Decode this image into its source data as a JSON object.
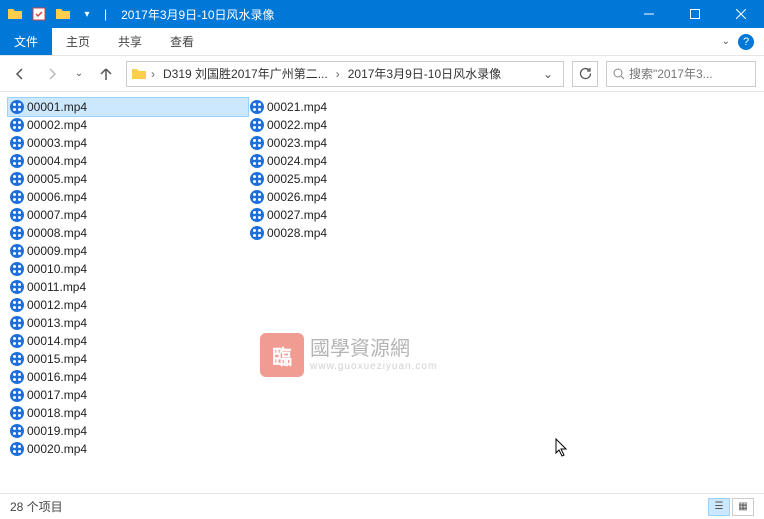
{
  "titlebar": {
    "title": "2017年3月9日-10日风水录像"
  },
  "ribbon": {
    "file": "文件",
    "home": "主页",
    "share": "共享",
    "view": "查看"
  },
  "breadcrumb": {
    "seg1": "D319 刘国胜2017年广州第二...",
    "seg2": "2017年3月9日-10日风水录像"
  },
  "search": {
    "placeholder": "搜索\"2017年3..."
  },
  "files": {
    "col1": [
      "00001.mp4",
      "00002.mp4",
      "00003.mp4",
      "00004.mp4",
      "00005.mp4",
      "00006.mp4",
      "00007.mp4",
      "00008.mp4",
      "00009.mp4",
      "00010.mp4",
      "00011.mp4",
      "00012.mp4",
      "00013.mp4",
      "00014.mp4",
      "00015.mp4",
      "00016.mp4",
      "00017.mp4",
      "00018.mp4",
      "00019.mp4",
      "00020.mp4"
    ],
    "col2": [
      "00021.mp4",
      "00022.mp4",
      "00023.mp4",
      "00024.mp4",
      "00025.mp4",
      "00026.mp4",
      "00027.mp4",
      "00028.mp4"
    ]
  },
  "watermark": {
    "seal": "臨",
    "text": "國學資源網",
    "url": "www.guoxueziyuan.com"
  },
  "statusbar": {
    "count": "28 个项目"
  }
}
